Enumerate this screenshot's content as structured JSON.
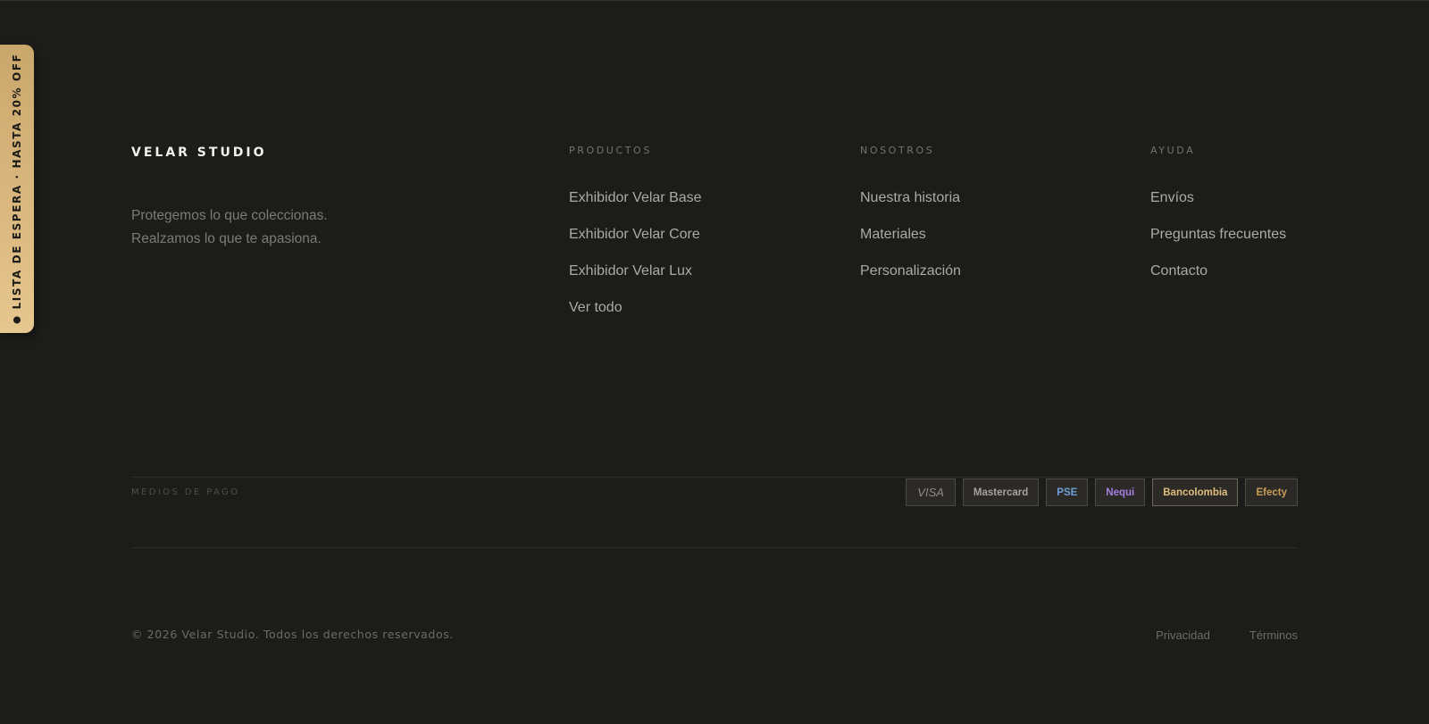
{
  "side_tab": {
    "label": "LISTA DE ESPERA · HASTA 20% OFF",
    "dot_icon": "bullet-icon"
  },
  "brand": {
    "name": "VELAR STUDIO",
    "tagline_line1": "Protegemos lo que coleccionas.",
    "tagline_line2": "Realzamos lo que te apasiona."
  },
  "columns": {
    "productos": {
      "heading": "PRODUCTOS",
      "links": [
        "Exhibidor Velar Base",
        "Exhibidor Velar Core",
        "Exhibidor Velar Lux",
        "Ver todo"
      ]
    },
    "nosotros": {
      "heading": "NOSOTROS",
      "links": [
        "Nuestra historia",
        "Materiales",
        "Personalización"
      ]
    },
    "ayuda": {
      "heading": "AYUDA",
      "links": [
        "Envíos",
        "Preguntas frecuentes",
        "Contacto"
      ]
    }
  },
  "payments": {
    "label": "MEDIOS DE PAGO",
    "methods": [
      "VISA",
      "Mastercard",
      "PSE",
      "Nequi",
      "Bancolombia",
      "Efecty"
    ]
  },
  "footer": {
    "copyright": "© 2026 Velar Studio. Todos los derechos reservados.",
    "privacy": "Privacidad",
    "terms": "Términos"
  },
  "colors": {
    "background": "#1c1c1a",
    "accent_gold": "#d9b77e",
    "pse": "#6e9fd6",
    "nequi": "#a57ee0",
    "bancolombia": "#e0bd7c",
    "efecty": "#c99c55"
  }
}
